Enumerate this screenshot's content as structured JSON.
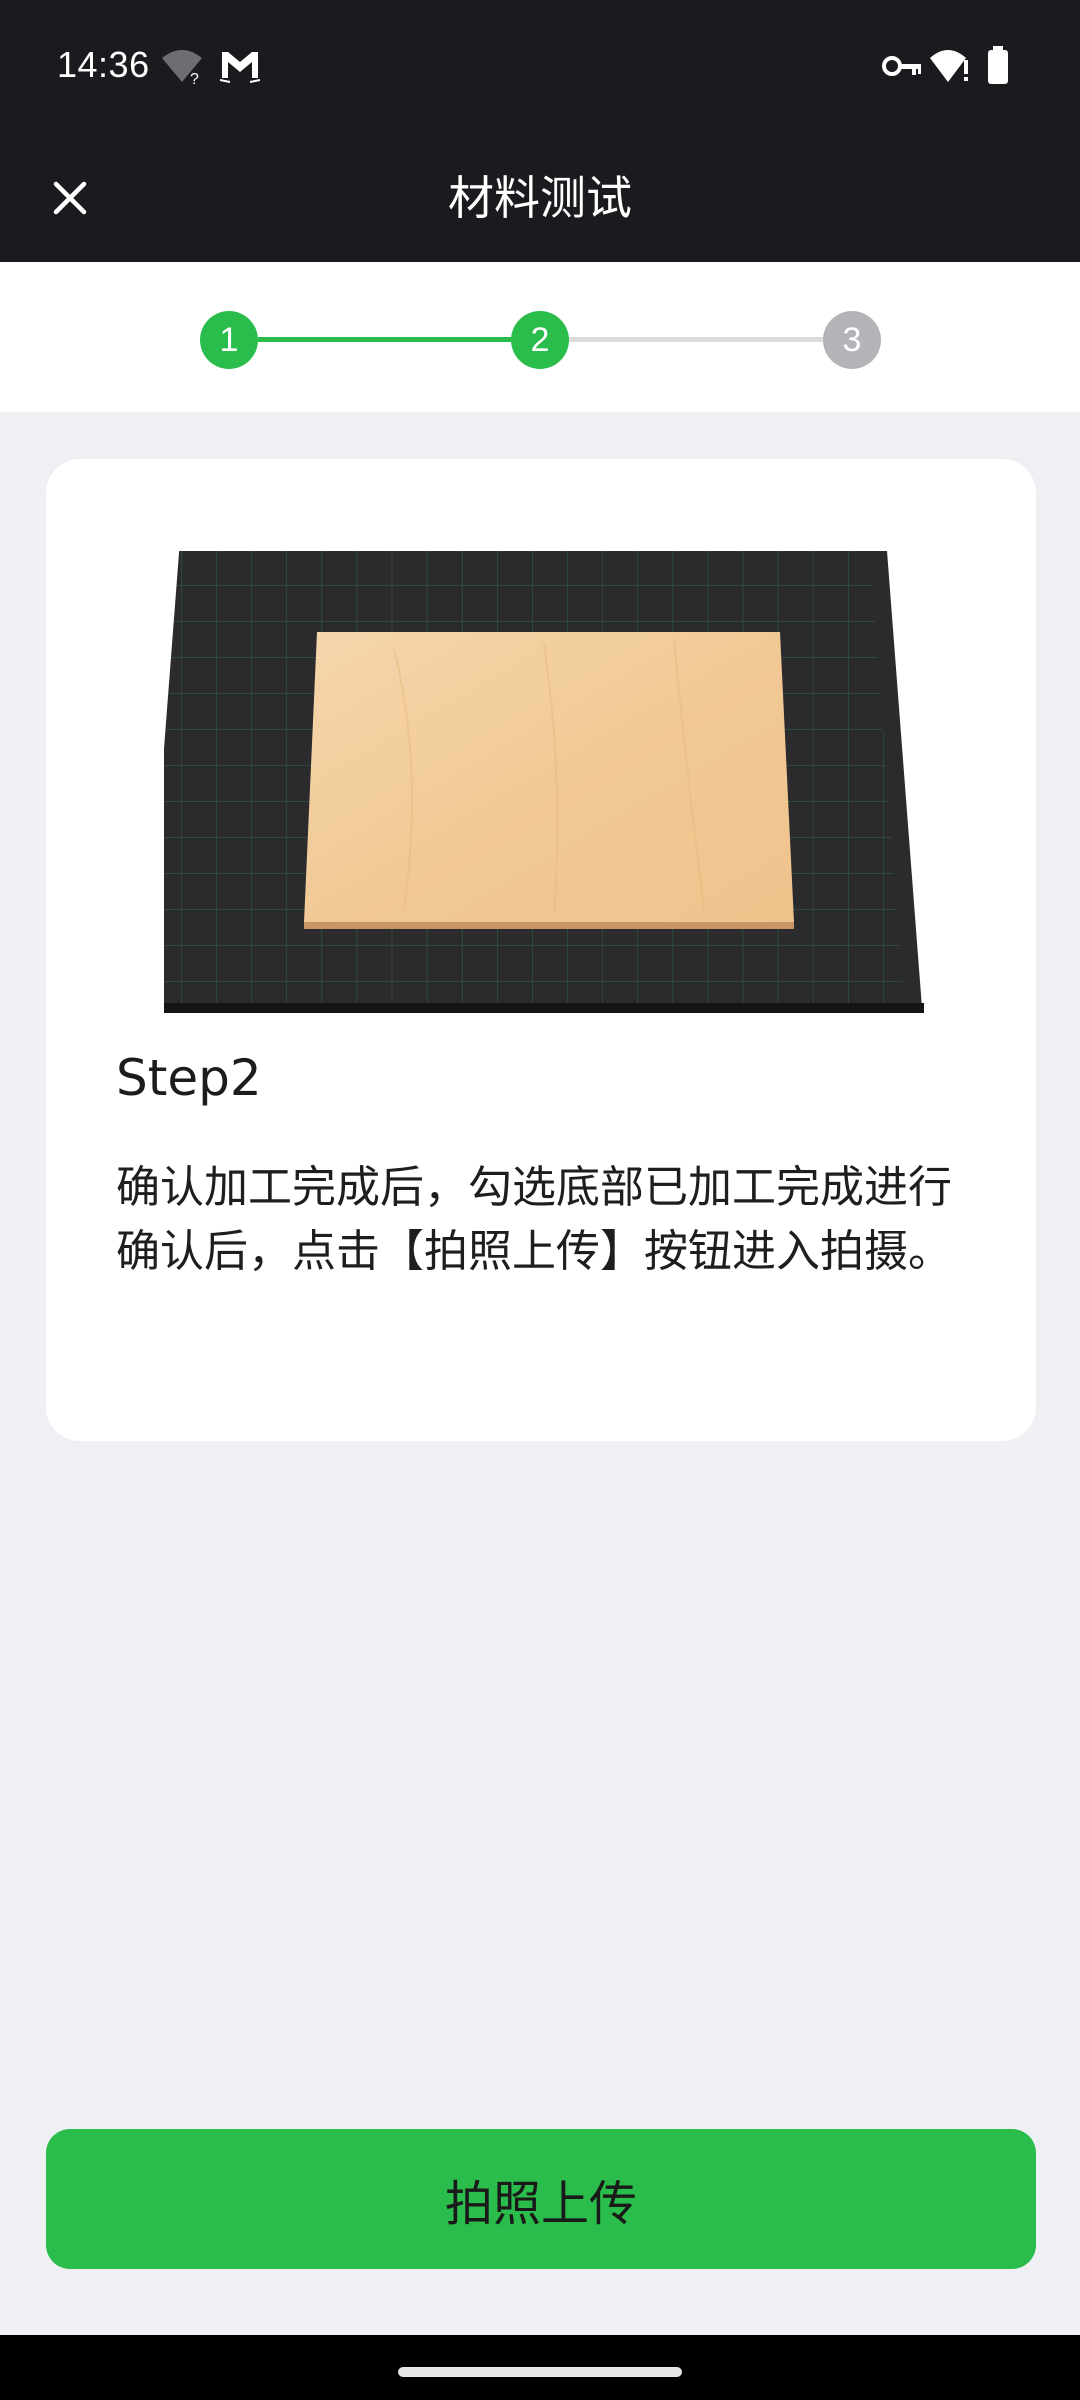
{
  "status_bar": {
    "time": "14:36",
    "icons": [
      "wifi-question-icon",
      "gmail-icon",
      "vpn-key-icon",
      "wifi-alert-icon",
      "battery-icon"
    ]
  },
  "app_bar": {
    "title": "材料测试",
    "close_icon": "close-icon"
  },
  "stepper": {
    "steps": [
      {
        "label": "1",
        "state": "complete",
        "color": "#2bbd4b"
      },
      {
        "label": "2",
        "state": "active",
        "color": "#2bbd4b"
      },
      {
        "label": "3",
        "state": "pending",
        "color": "#b4b4b8"
      }
    ],
    "active_color": "#2bbd4b",
    "inactive_color": "#dcdcdc"
  },
  "card": {
    "illustration": "wood-board-on-grid-bed",
    "step_title": "Step2",
    "description": "确认加工完成后，勾选底部已加工完成进行确认后，点击【拍照上传】按钮进入拍摄。"
  },
  "action_button": {
    "label": "拍照上传",
    "color": "#2bbd4b"
  }
}
